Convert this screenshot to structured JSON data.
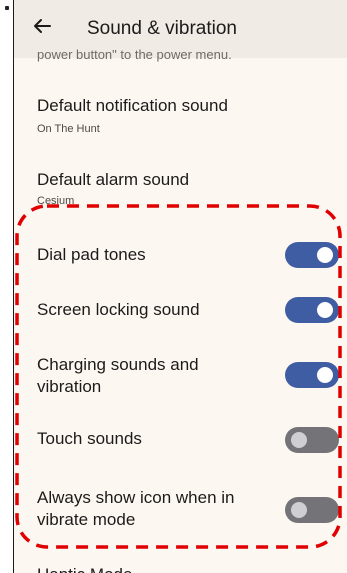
{
  "header": {
    "title": "Sound & vibration",
    "back_icon": "arrow-left-icon"
  },
  "cut_off_text": "power button\" to the power menu.",
  "settings": [
    {
      "label": "Default notification sound",
      "summary": "On The Hunt"
    },
    {
      "label": "Default alarm sound",
      "summary": "Cesium"
    }
  ],
  "toggles": [
    {
      "label": "Dial pad tones",
      "state": "on"
    },
    {
      "label": "Screen locking sound",
      "state": "on"
    },
    {
      "label_line1": "Charging sounds and",
      "label_line2": "vibration",
      "state": "on"
    },
    {
      "label": "Touch sounds",
      "state": "off"
    },
    {
      "label_line1": "Always show icon when in",
      "label_line2": "vibrate mode",
      "state": "off"
    }
  ],
  "bottom_cut_text": "Haptic Mode",
  "colors": {
    "toggle_on": "#3f5da3",
    "toggle_off": "#747478",
    "annotation": "#e00000"
  }
}
